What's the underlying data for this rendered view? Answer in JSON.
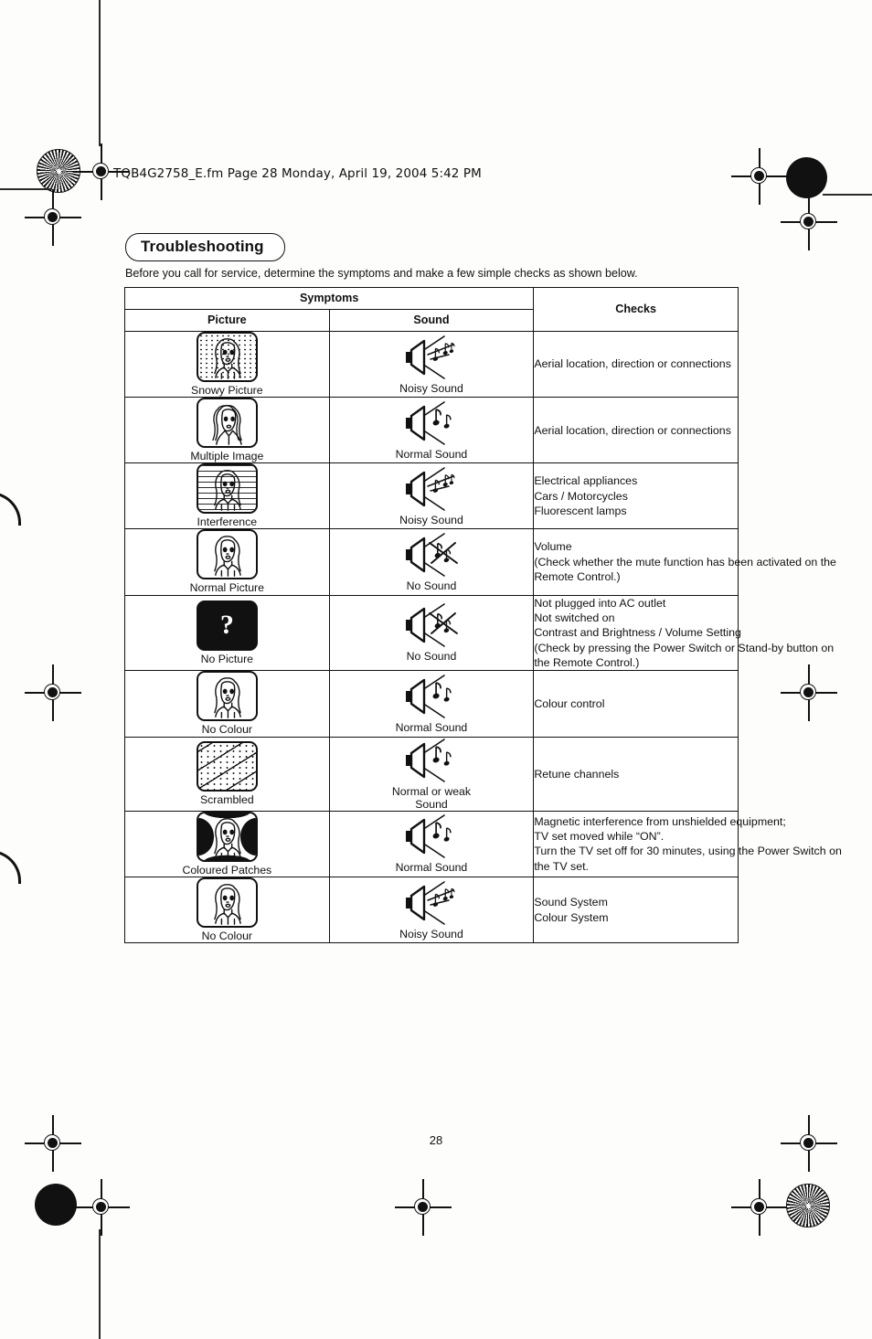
{
  "document": {
    "fm_header": "TQB4G2758_E.fm  Page 28  Monday, April 19, 2004  5:42 PM",
    "section_title": "Troubleshooting",
    "intro": "Before you call for service, determine the symptoms and make a few simple checks as shown below.",
    "page_number": "28"
  },
  "table": {
    "header_symptoms": "Symptoms",
    "header_picture": "Picture",
    "header_sound": "Sound",
    "header_checks": "Checks",
    "rows": [
      {
        "picture_label": "Snowy Picture",
        "picture_icon": "tv-snowy-picture-icon",
        "sound_label": "Noisy Sound",
        "sound_icon": "speaker-noisy-icon",
        "checks": [
          "Aerial location, direction or connections"
        ]
      },
      {
        "picture_label": "Multiple Image",
        "picture_icon": "tv-multiple-image-icon",
        "sound_label": "Normal Sound",
        "sound_icon": "speaker-normal-icon",
        "checks": [
          "Aerial location, direction or connections"
        ]
      },
      {
        "picture_label": "Interference",
        "picture_icon": "tv-interference-icon",
        "sound_label": "Noisy Sound",
        "sound_icon": "speaker-noisy-icon",
        "checks": [
          "Electrical appliances",
          "Cars / Motorcycles",
          "Fluorescent lamps"
        ]
      },
      {
        "picture_label": "Normal Picture",
        "picture_icon": "tv-normal-picture-icon",
        "sound_label": "No Sound",
        "sound_icon": "speaker-muted-icon",
        "checks": [
          "Volume",
          "(Check whether the mute function has been activated on the",
          "Remote Control.)"
        ]
      },
      {
        "picture_label": "No Picture",
        "picture_icon": "tv-no-picture-icon",
        "sound_label": "No Sound",
        "sound_icon": "speaker-muted-icon",
        "checks": [
          "Not plugged into AC outlet",
          "Not switched on",
          "Contrast and Brightness / Volume Setting",
          "(Check by pressing the Power Switch or Stand-by button on",
          "the Remote Control.)"
        ]
      },
      {
        "picture_label": "No Colour",
        "picture_icon": "tv-no-colour-icon",
        "sound_label": "Normal Sound",
        "sound_icon": "speaker-normal-icon",
        "checks": [
          "Colour control"
        ]
      },
      {
        "picture_label": "Scrambled",
        "picture_icon": "tv-scrambled-icon",
        "sound_label": "Normal or weak\nSound",
        "sound_icon": "speaker-normal-icon",
        "checks": [
          "Retune channels"
        ]
      },
      {
        "picture_label": "Coloured Patches",
        "picture_icon": "tv-coloured-patches-icon",
        "sound_label": "Normal Sound",
        "sound_icon": "speaker-normal-icon",
        "checks": [
          "Magnetic interference from unshielded equipment;",
          "TV set moved while “ON”.",
          "Turn the TV set off for 30 minutes, using the Power Switch on",
          "the TV set."
        ]
      },
      {
        "picture_label": "No Colour",
        "picture_icon": "tv-no-colour-icon",
        "sound_label": "Noisy Sound",
        "sound_icon": "speaker-noisy-icon",
        "checks": [
          "Sound System",
          "Colour System"
        ]
      }
    ]
  },
  "no_picture_glyph": "?",
  "colors": {
    "ink": "#111111",
    "paper": "#fdfdfb"
  }
}
